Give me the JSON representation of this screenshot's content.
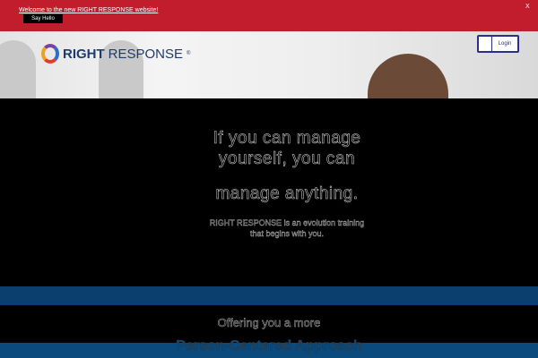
{
  "banner": {
    "message": "Welcome to the new RIGHT RESPONSE website!",
    "button": "Say Hello",
    "close": "X"
  },
  "header": {
    "logo_bold": "RIGHT",
    "logo_light": "RESPONSE",
    "logo_reg": "®",
    "login": "Login"
  },
  "hero": {
    "line1": "If you can manage",
    "line2": "yourself, you can",
    "line3": "manage anything.",
    "sub1": "RIGHT RESPONSE is an evolution training",
    "sub2": "that begins with you."
  },
  "section": {
    "offer": "Offering you a more",
    "title": "Person-Centered Approach"
  },
  "colors": {
    "banner": "#c21d2c",
    "brand_blue": "#0b4a7c",
    "login_border": "#2b2e8f"
  }
}
